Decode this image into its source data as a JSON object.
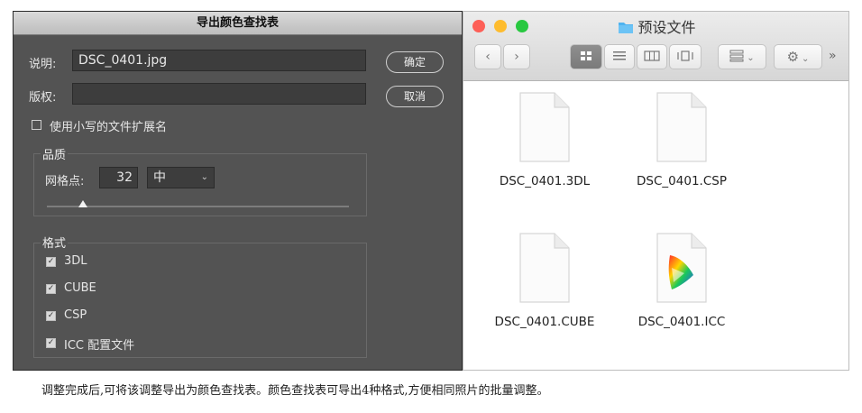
{
  "dialog": {
    "title": "导出颜色查找表",
    "description_label": "说明:",
    "description_value": "DSC_0401.jpg",
    "copyright_label": "版权:",
    "copyright_value": "",
    "ok_button": "确定",
    "cancel_button": "取消",
    "lowercase_ext_label": "使用小写的文件扩展名",
    "quality_group": "品质",
    "grid_points_label": "网格点:",
    "grid_points_value": "32",
    "quality_select": "中",
    "slider_level": 0.12,
    "format_group": "格式",
    "formats": [
      {
        "label": "3DL",
        "checked": true
      },
      {
        "label": "CUBE",
        "checked": true
      },
      {
        "label": "CSP",
        "checked": true
      },
      {
        "label": "ICC 配置文件",
        "checked": true
      }
    ]
  },
  "finder": {
    "title": "预设文件",
    "files": [
      "DSC_0401.3DL",
      "DSC_0401.CSP",
      "DSC_0401.CUBE",
      "DSC_0401.ICC"
    ],
    "colors": {
      "close": "#fd5f57",
      "minimize": "#febc2e",
      "zoom": "#28c840",
      "folder": "#4fb3f0"
    }
  },
  "caption": "调整完成后,可将该调整导出为颜色查找表。颜色查找表可导出4种格式,方便相同照片的批量调整。"
}
